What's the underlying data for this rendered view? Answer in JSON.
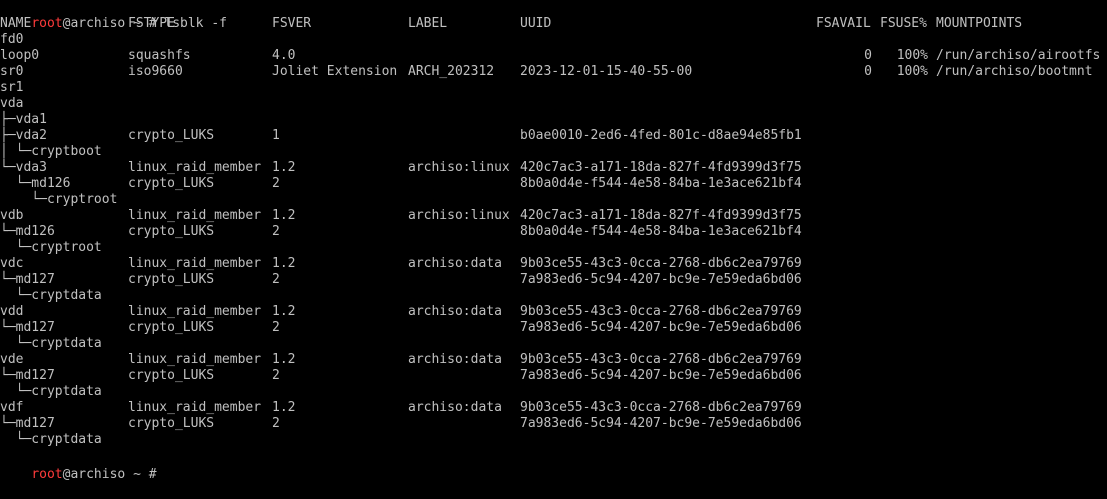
{
  "prompt": {
    "user": "root",
    "rest": "@archiso ~ # ",
    "color": "#ff3b3b"
  },
  "command": "lsblk -f",
  "header": {
    "name": "NAME",
    "fstype": "FSTYPE",
    "fsver": "FSVER",
    "label": "LABEL",
    "uuid": "UUID",
    "fsavail": "FSAVAIL",
    "fsuse": "FSUSE%",
    "mountpoints": "MOUNTPOINTS"
  },
  "rows": [
    {
      "name": "fd0",
      "fstype": "",
      "fsver": "",
      "label": "",
      "uuid": "",
      "fsavail": "",
      "fsuse": "",
      "mount": ""
    },
    {
      "name": "loop0",
      "fstype": "squashfs",
      "fsver": "4.0",
      "label": "",
      "uuid": "",
      "fsavail": "0",
      "fsuse": "100%",
      "mount": "/run/archiso/airootfs"
    },
    {
      "name": "sr0",
      "fstype": "iso9660",
      "fsver": "Joliet Extension",
      "label": "ARCH_202312",
      "uuid": "2023-12-01-15-40-55-00",
      "fsavail": "0",
      "fsuse": "100%",
      "mount": "/run/archiso/bootmnt"
    },
    {
      "name": "sr1",
      "fstype": "",
      "fsver": "",
      "label": "",
      "uuid": "",
      "fsavail": "",
      "fsuse": "",
      "mount": ""
    },
    {
      "name": "vda",
      "fstype": "",
      "fsver": "",
      "label": "",
      "uuid": "",
      "fsavail": "",
      "fsuse": "",
      "mount": ""
    },
    {
      "name": "├─vda1",
      "fstype": "",
      "fsver": "",
      "label": "",
      "uuid": "",
      "fsavail": "",
      "fsuse": "",
      "mount": ""
    },
    {
      "name": "├─vda2",
      "fstype": "crypto_LUKS",
      "fsver": "1",
      "label": "",
      "uuid": "b0ae0010-2ed6-4fed-801c-d8ae94e85fb1",
      "fsavail": "",
      "fsuse": "",
      "mount": ""
    },
    {
      "name": "│ └─cryptboot",
      "fstype": "",
      "fsver": "",
      "label": "",
      "uuid": "",
      "fsavail": "",
      "fsuse": "",
      "mount": ""
    },
    {
      "name": "└─vda3",
      "fstype": "linux_raid_member",
      "fsver": "1.2",
      "label": "archiso:linux",
      "uuid": "420c7ac3-a171-18da-827f-4fd9399d3f75",
      "fsavail": "",
      "fsuse": "",
      "mount": ""
    },
    {
      "name": "  └─md126",
      "fstype": "crypto_LUKS",
      "fsver": "2",
      "label": "",
      "uuid": "8b0a0d4e-f544-4e58-84ba-1e3ace621bf4",
      "fsavail": "",
      "fsuse": "",
      "mount": ""
    },
    {
      "name": "    └─cryptroot",
      "fstype": "",
      "fsver": "",
      "label": "",
      "uuid": "",
      "fsavail": "",
      "fsuse": "",
      "mount": ""
    },
    {
      "name": "vdb",
      "fstype": "linux_raid_member",
      "fsver": "1.2",
      "label": "archiso:linux",
      "uuid": "420c7ac3-a171-18da-827f-4fd9399d3f75",
      "fsavail": "",
      "fsuse": "",
      "mount": ""
    },
    {
      "name": "└─md126",
      "fstype": "crypto_LUKS",
      "fsver": "2",
      "label": "",
      "uuid": "8b0a0d4e-f544-4e58-84ba-1e3ace621bf4",
      "fsavail": "",
      "fsuse": "",
      "mount": ""
    },
    {
      "name": "  └─cryptroot",
      "fstype": "",
      "fsver": "",
      "label": "",
      "uuid": "",
      "fsavail": "",
      "fsuse": "",
      "mount": ""
    },
    {
      "name": "vdc",
      "fstype": "linux_raid_member",
      "fsver": "1.2",
      "label": "archiso:data",
      "uuid": "9b03ce55-43c3-0cca-2768-db6c2ea79769",
      "fsavail": "",
      "fsuse": "",
      "mount": ""
    },
    {
      "name": "└─md127",
      "fstype": "crypto_LUKS",
      "fsver": "2",
      "label": "",
      "uuid": "7a983ed6-5c94-4207-bc9e-7e59eda6bd06",
      "fsavail": "",
      "fsuse": "",
      "mount": ""
    },
    {
      "name": "  └─cryptdata",
      "fstype": "",
      "fsver": "",
      "label": "",
      "uuid": "",
      "fsavail": "",
      "fsuse": "",
      "mount": ""
    },
    {
      "name": "vdd",
      "fstype": "linux_raid_member",
      "fsver": "1.2",
      "label": "archiso:data",
      "uuid": "9b03ce55-43c3-0cca-2768-db6c2ea79769",
      "fsavail": "",
      "fsuse": "",
      "mount": ""
    },
    {
      "name": "└─md127",
      "fstype": "crypto_LUKS",
      "fsver": "2",
      "label": "",
      "uuid": "7a983ed6-5c94-4207-bc9e-7e59eda6bd06",
      "fsavail": "",
      "fsuse": "",
      "mount": ""
    },
    {
      "name": "  └─cryptdata",
      "fstype": "",
      "fsver": "",
      "label": "",
      "uuid": "",
      "fsavail": "",
      "fsuse": "",
      "mount": ""
    },
    {
      "name": "vde",
      "fstype": "linux_raid_member",
      "fsver": "1.2",
      "label": "archiso:data",
      "uuid": "9b03ce55-43c3-0cca-2768-db6c2ea79769",
      "fsavail": "",
      "fsuse": "",
      "mount": ""
    },
    {
      "name": "└─md127",
      "fstype": "crypto_LUKS",
      "fsver": "2",
      "label": "",
      "uuid": "7a983ed6-5c94-4207-bc9e-7e59eda6bd06",
      "fsavail": "",
      "fsuse": "",
      "mount": ""
    },
    {
      "name": "  └─cryptdata",
      "fstype": "",
      "fsver": "",
      "label": "",
      "uuid": "",
      "fsavail": "",
      "fsuse": "",
      "mount": ""
    },
    {
      "name": "vdf",
      "fstype": "linux_raid_member",
      "fsver": "1.2",
      "label": "archiso:data",
      "uuid": "9b03ce55-43c3-0cca-2768-db6c2ea79769",
      "fsavail": "",
      "fsuse": "",
      "mount": ""
    },
    {
      "name": "└─md127",
      "fstype": "crypto_LUKS",
      "fsver": "2",
      "label": "",
      "uuid": "7a983ed6-5c94-4207-bc9e-7e59eda6bd06",
      "fsavail": "",
      "fsuse": "",
      "mount": ""
    },
    {
      "name": "  └─cryptdata",
      "fstype": "",
      "fsver": "",
      "label": "",
      "uuid": "",
      "fsavail": "",
      "fsuse": "",
      "mount": ""
    }
  ]
}
